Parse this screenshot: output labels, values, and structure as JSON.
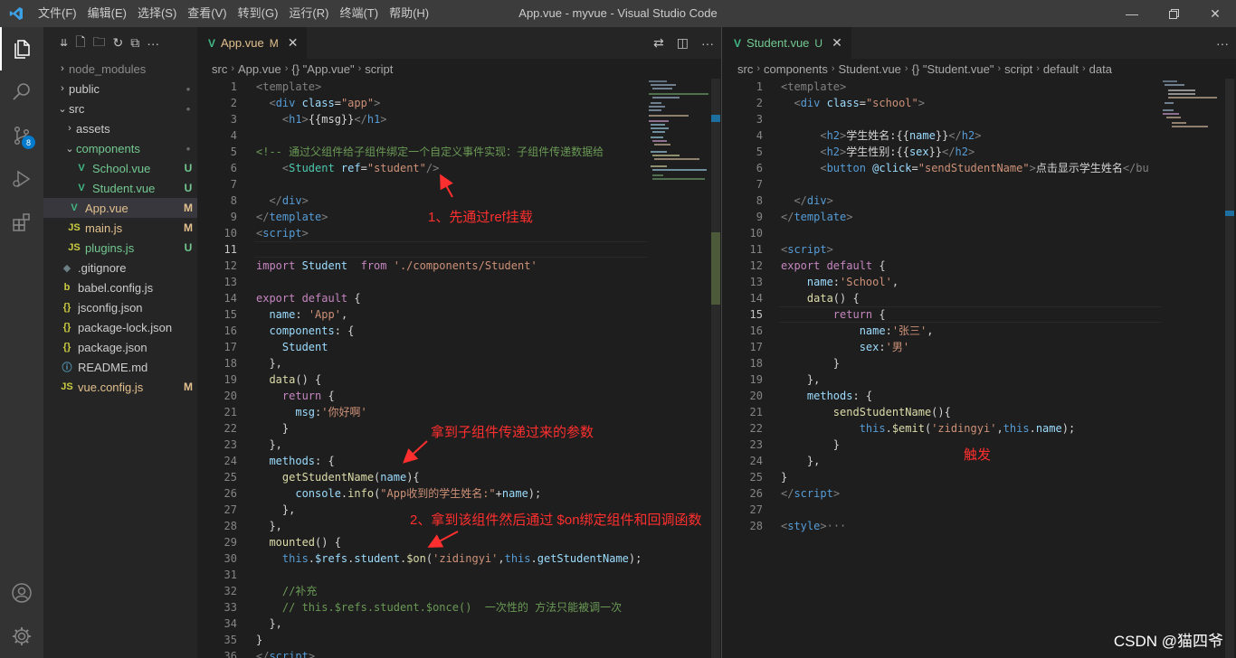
{
  "window": {
    "title": "App.vue - myvue - Visual Studio Code",
    "menu": [
      "文件(F)",
      "编辑(E)",
      "选择(S)",
      "查看(V)",
      "转到(G)",
      "运行(R)",
      "终端(T)",
      "帮助(H)"
    ]
  },
  "activity_bar": {
    "source_control_badge": "8"
  },
  "explorer": {
    "items": [
      {
        "label": "node_modules",
        "kind": "folder",
        "state": "collapsed",
        "depth": 0,
        "color": "#8b8b8b",
        "status": ""
      },
      {
        "label": "public",
        "kind": "folder",
        "state": "collapsed",
        "depth": 0,
        "color": "#cccccc",
        "status": "●"
      },
      {
        "label": "src",
        "kind": "folder",
        "state": "expanded",
        "depth": 0,
        "color": "#cccccc",
        "status": "●"
      },
      {
        "label": "assets",
        "kind": "folder",
        "state": "collapsed",
        "depth": 1,
        "color": "#cccccc",
        "status": ""
      },
      {
        "label": "components",
        "kind": "folder",
        "state": "expanded",
        "depth": 1,
        "color": "#73c991",
        "status": "●"
      },
      {
        "label": "School.vue",
        "kind": "vue",
        "depth": 2,
        "color": "#73c991",
        "status": "U"
      },
      {
        "label": "Student.vue",
        "kind": "vue",
        "depth": 2,
        "color": "#73c991",
        "status": "U"
      },
      {
        "label": "App.vue",
        "kind": "vue",
        "depth": 1,
        "color": "#e2c08d",
        "status": "M",
        "selected": true
      },
      {
        "label": "main.js",
        "kind": "js",
        "depth": 1,
        "color": "#e2c08d",
        "status": "M"
      },
      {
        "label": "plugins.js",
        "kind": "js",
        "depth": 1,
        "color": "#73c991",
        "status": "U"
      },
      {
        "label": ".gitignore",
        "kind": "git",
        "depth": 0,
        "color": "#cccccc",
        "status": ""
      },
      {
        "label": "babel.config.js",
        "kind": "babel",
        "depth": 0,
        "color": "#cccccc",
        "status": ""
      },
      {
        "label": "jsconfig.json",
        "kind": "json",
        "depth": 0,
        "color": "#cccccc",
        "status": ""
      },
      {
        "label": "package-lock.json",
        "kind": "json",
        "depth": 0,
        "color": "#cccccc",
        "status": ""
      },
      {
        "label": "package.json",
        "kind": "json",
        "depth": 0,
        "color": "#cccccc",
        "status": ""
      },
      {
        "label": "README.md",
        "kind": "info",
        "depth": 0,
        "color": "#cccccc",
        "status": ""
      },
      {
        "label": "vue.config.js",
        "kind": "js",
        "depth": 0,
        "color": "#e2c08d",
        "status": "M"
      }
    ]
  },
  "editor_left": {
    "tab": {
      "label": "App.vue",
      "mark": "M"
    },
    "breadcrumb": [
      "src",
      "App.vue",
      "{} \"App.vue\"",
      "script"
    ],
    "current_line": 11,
    "lines": [
      [
        [
          "<template>",
          "#808080"
        ]
      ],
      [
        [
          "  <",
          "#808080"
        ],
        [
          "div ",
          "#569cd6"
        ],
        [
          "class",
          "#9cdcfe"
        ],
        [
          "=",
          "#d4d4d4"
        ],
        [
          "\"app\"",
          "#ce9178"
        ],
        [
          ">",
          "#808080"
        ]
      ],
      [
        [
          "    <",
          "#808080"
        ],
        [
          "h1",
          "#569cd6"
        ],
        [
          ">",
          "#808080"
        ],
        [
          "{{msg}}",
          "#d4d4d4"
        ],
        [
          "</",
          "#808080"
        ],
        [
          "h1",
          "#569cd6"
        ],
        [
          ">",
          "#808080"
        ]
      ],
      [],
      [
        [
          "<!-- 通过父组件给子组件绑定一个自定义事件实现：子组件传递数据给",
          "#6a9955"
        ]
      ],
      [
        [
          "    <",
          "#808080"
        ],
        [
          "Student ",
          "#4ec9b0"
        ],
        [
          "ref",
          "#9cdcfe"
        ],
        [
          "=",
          "#d4d4d4"
        ],
        [
          "\"student\"",
          "#ce9178"
        ],
        [
          "/>",
          "#808080"
        ]
      ],
      [],
      [
        [
          "  </",
          "#808080"
        ],
        [
          "div",
          "#569cd6"
        ],
        [
          ">",
          "#808080"
        ]
      ],
      [
        [
          "</",
          "#808080"
        ],
        [
          "template",
          "#569cd6"
        ],
        [
          ">",
          "#808080"
        ]
      ],
      [
        [
          "<",
          "#808080"
        ],
        [
          "script",
          "#569cd6"
        ],
        [
          ">",
          "#808080"
        ]
      ],
      [],
      [
        [
          "import ",
          "#c586c0"
        ],
        [
          "Student  ",
          "#9cdcfe"
        ],
        [
          "from ",
          "#c586c0"
        ],
        [
          "'./components/Student'",
          "#ce9178"
        ]
      ],
      [],
      [
        [
          "export default ",
          "#c586c0"
        ],
        [
          "{",
          "#d4d4d4"
        ]
      ],
      [
        [
          "  name",
          "#9cdcfe"
        ],
        [
          ": ",
          "#d4d4d4"
        ],
        [
          "'App'",
          "#ce9178"
        ],
        [
          ",",
          "#d4d4d4"
        ]
      ],
      [
        [
          "  components",
          "#9cdcfe"
        ],
        [
          ": {",
          "#d4d4d4"
        ]
      ],
      [
        [
          "    Student",
          "#9cdcfe"
        ]
      ],
      [
        [
          "  },",
          "#d4d4d4"
        ]
      ],
      [
        [
          "  data",
          "#dcdcaa"
        ],
        [
          "() {",
          "#d4d4d4"
        ]
      ],
      [
        [
          "    return ",
          "#c586c0"
        ],
        [
          "{",
          "#d4d4d4"
        ]
      ],
      [
        [
          "      msg",
          "#9cdcfe"
        ],
        [
          ":",
          "#d4d4d4"
        ],
        [
          "'你好啊'",
          "#ce9178"
        ]
      ],
      [
        [
          "    }",
          "#d4d4d4"
        ]
      ],
      [
        [
          "  },",
          "#d4d4d4"
        ]
      ],
      [
        [
          "  methods",
          "#9cdcfe"
        ],
        [
          ": {",
          "#d4d4d4"
        ]
      ],
      [
        [
          "    getStudentName",
          "#dcdcaa"
        ],
        [
          "(",
          "#d4d4d4"
        ],
        [
          "name",
          "#9cdcfe"
        ],
        [
          "){",
          "#d4d4d4"
        ]
      ],
      [
        [
          "      console",
          "#9cdcfe"
        ],
        [
          ".",
          "#d4d4d4"
        ],
        [
          "info",
          "#dcdcaa"
        ],
        [
          "(",
          "#d4d4d4"
        ],
        [
          "\"App收到的学生姓名:\"",
          "#ce9178"
        ],
        [
          "+",
          "#d4d4d4"
        ],
        [
          "name",
          "#9cdcfe"
        ],
        [
          ");",
          "#d4d4d4"
        ]
      ],
      [
        [
          "    },",
          "#d4d4d4"
        ]
      ],
      [
        [
          "  },",
          "#d4d4d4"
        ]
      ],
      [
        [
          "  mounted",
          "#dcdcaa"
        ],
        [
          "() {",
          "#d4d4d4"
        ]
      ],
      [
        [
          "    this",
          "#569cd6"
        ],
        [
          ".",
          "#d4d4d4"
        ],
        [
          "$refs",
          "#9cdcfe"
        ],
        [
          ".",
          "#d4d4d4"
        ],
        [
          "student",
          "#9cdcfe"
        ],
        [
          ".",
          "#d4d4d4"
        ],
        [
          "$on",
          "#dcdcaa"
        ],
        [
          "(",
          "#d4d4d4"
        ],
        [
          "'zidingyi'",
          "#ce9178"
        ],
        [
          ",",
          "#d4d4d4"
        ],
        [
          "this",
          "#569cd6"
        ],
        [
          ".",
          "#d4d4d4"
        ],
        [
          "getStudentName",
          "#9cdcfe"
        ],
        [
          ");",
          "#d4d4d4"
        ]
      ],
      [],
      [
        [
          "    //补充",
          "#6a9955"
        ]
      ],
      [
        [
          "    // this.$refs.student.$once()  一次性的 方法只能被调一次",
          "#6a9955"
        ]
      ],
      [
        [
          "  },",
          "#d4d4d4"
        ]
      ],
      [
        [
          "}",
          "#d4d4d4"
        ]
      ],
      [
        [
          "</",
          "#808080"
        ],
        [
          "script",
          "#569cd6"
        ],
        [
          ">",
          "#808080"
        ]
      ]
    ]
  },
  "editor_right": {
    "tab": {
      "label": "Student.vue",
      "mark": "U"
    },
    "breadcrumb": [
      "src",
      "components",
      "Student.vue",
      "{} \"Student.vue\"",
      "script",
      "default",
      "data"
    ],
    "current_line": 15,
    "lines": [
      [
        [
          "<template>",
          "#808080"
        ]
      ],
      [
        [
          "  <",
          "#808080"
        ],
        [
          "div ",
          "#569cd6"
        ],
        [
          "class",
          "#9cdcfe"
        ],
        [
          "=",
          "#d4d4d4"
        ],
        [
          "\"school\"",
          "#ce9178"
        ],
        [
          ">",
          "#808080"
        ]
      ],
      [],
      [
        [
          "      <",
          "#808080"
        ],
        [
          "h2",
          "#569cd6"
        ],
        [
          ">",
          "#808080"
        ],
        [
          "学生姓名:{{",
          "#d4d4d4"
        ],
        [
          "name",
          "#9cdcfe"
        ],
        [
          "}}",
          "#d4d4d4"
        ],
        [
          "</",
          "#808080"
        ],
        [
          "h2",
          "#569cd6"
        ],
        [
          ">",
          "#808080"
        ]
      ],
      [
        [
          "      <",
          "#808080"
        ],
        [
          "h2",
          "#569cd6"
        ],
        [
          ">",
          "#808080"
        ],
        [
          "学生性别:{{",
          "#d4d4d4"
        ],
        [
          "sex",
          "#9cdcfe"
        ],
        [
          "}}",
          "#d4d4d4"
        ],
        [
          "</",
          "#808080"
        ],
        [
          "h2",
          "#569cd6"
        ],
        [
          ">",
          "#808080"
        ]
      ],
      [
        [
          "      <",
          "#808080"
        ],
        [
          "button ",
          "#569cd6"
        ],
        [
          "@click",
          "#9cdcfe"
        ],
        [
          "=",
          "#d4d4d4"
        ],
        [
          "\"sendStudentName\"",
          "#ce9178"
        ],
        [
          ">",
          "#808080"
        ],
        [
          "点击显示学生姓名",
          "#d4d4d4"
        ],
        [
          "</bu",
          "#808080"
        ]
      ],
      [],
      [
        [
          "  </",
          "#808080"
        ],
        [
          "div",
          "#569cd6"
        ],
        [
          ">",
          "#808080"
        ]
      ],
      [
        [
          "</",
          "#808080"
        ],
        [
          "template",
          "#569cd6"
        ],
        [
          ">",
          "#808080"
        ]
      ],
      [],
      [
        [
          "<",
          "#808080"
        ],
        [
          "script",
          "#569cd6"
        ],
        [
          ">",
          "#808080"
        ]
      ],
      [
        [
          "export default ",
          "#c586c0"
        ],
        [
          "{",
          "#d4d4d4"
        ]
      ],
      [
        [
          "    name",
          "#9cdcfe"
        ],
        [
          ":",
          "#d4d4d4"
        ],
        [
          "'School'",
          "#ce9178"
        ],
        [
          ",",
          "#d4d4d4"
        ]
      ],
      [
        [
          "    data",
          "#dcdcaa"
        ],
        [
          "() {",
          "#d4d4d4"
        ]
      ],
      [
        [
          "        return ",
          "#c586c0"
        ],
        [
          "{",
          "#d4d4d4"
        ]
      ],
      [
        [
          "            name",
          "#9cdcfe"
        ],
        [
          ":",
          "#d4d4d4"
        ],
        [
          "'张三'",
          "#ce9178"
        ],
        [
          ",",
          "#d4d4d4"
        ]
      ],
      [
        [
          "            sex",
          "#9cdcfe"
        ],
        [
          ":",
          "#d4d4d4"
        ],
        [
          "'男'",
          "#ce9178"
        ]
      ],
      [
        [
          "        }",
          "#d4d4d4"
        ]
      ],
      [
        [
          "    },",
          "#d4d4d4"
        ]
      ],
      [
        [
          "    methods",
          "#9cdcfe"
        ],
        [
          ": {",
          "#d4d4d4"
        ]
      ],
      [
        [
          "        sendStudentName",
          "#dcdcaa"
        ],
        [
          "(){",
          "#d4d4d4"
        ]
      ],
      [
        [
          "            this",
          "#569cd6"
        ],
        [
          ".",
          "#d4d4d4"
        ],
        [
          "$emit",
          "#dcdcaa"
        ],
        [
          "(",
          "#d4d4d4"
        ],
        [
          "'zidingyi'",
          "#ce9178"
        ],
        [
          ",",
          "#d4d4d4"
        ],
        [
          "this",
          "#569cd6"
        ],
        [
          ".",
          "#d4d4d4"
        ],
        [
          "name",
          "#9cdcfe"
        ],
        [
          ");",
          "#d4d4d4"
        ]
      ],
      [
        [
          "        }",
          "#d4d4d4"
        ]
      ],
      [
        [
          "    },",
          "#d4d4d4"
        ]
      ],
      [
        [
          "}",
          "#d4d4d4"
        ]
      ],
      [
        [
          "</",
          "#808080"
        ],
        [
          "script",
          "#569cd6"
        ],
        [
          ">",
          "#808080"
        ]
      ],
      [],
      [
        [
          "<",
          "#808080"
        ],
        [
          "style",
          "#569cd6"
        ],
        [
          ">",
          "#808080"
        ],
        [
          "···",
          "#808080"
        ]
      ]
    ]
  },
  "annotations": {
    "ref_mount": "1、先通过ref挂载",
    "receive_params": "拿到子组件传递过来的参数",
    "bind_on": "2、拿到该组件然后通过 $on绑定组件和回调函数",
    "trigger": "触发"
  },
  "watermark": "CSDN @猫四爷"
}
